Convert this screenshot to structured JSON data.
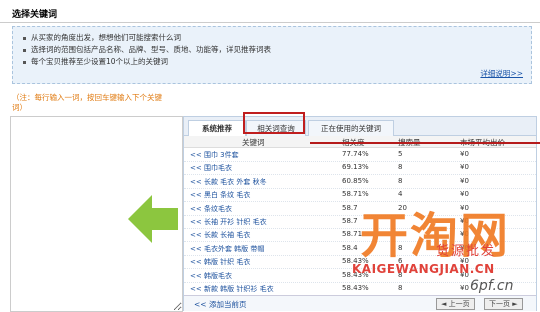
{
  "header": {
    "title": "选择关键词"
  },
  "tips": {
    "items": [
      "从买家的角度出发，想想他们可能搜索什么词",
      "选择词的范围包括产品名称、品牌、型号、质地、功能等，详见推荐词表",
      "每个宝贝推荐至少设置10个以上的关键词"
    ],
    "detail_link": "详细说明>>"
  },
  "note": {
    "text": "（注：每行输入一词，按回车键输入下个关键词）"
  },
  "tabs": [
    {
      "label": "系统推荐"
    },
    {
      "label": "相关词查询"
    },
    {
      "label": "正在使用的关键词"
    }
  ],
  "table": {
    "headers": [
      "关键词",
      "相关度",
      "搜索量",
      "市场平均出价"
    ],
    "rows": [
      {
        "keyword": "<< 围巾 3件套",
        "relevance": "77.74%",
        "volume": "5",
        "price": "¥0"
      },
      {
        "keyword": "<< 围巾毛衣",
        "relevance": "69.13%",
        "volume": "8",
        "price": "¥0"
      },
      {
        "keyword": "<< 长款 毛衣 外套 秋冬",
        "relevance": "60.85%",
        "volume": "8",
        "price": "¥0"
      },
      {
        "keyword": "<< 黑白 条纹 毛衣",
        "relevance": "58.71%",
        "volume": "4",
        "price": "¥0"
      },
      {
        "keyword": "<< 条纹毛衣",
        "relevance": "58.7",
        "volume": "20",
        "price": "¥0"
      },
      {
        "keyword": "<< 长袖 开衫 针织 毛衣",
        "relevance": "58.7",
        "volume": "",
        "price": "¥0"
      },
      {
        "keyword": "<< 长款 长袖 毛衣",
        "relevance": "58.71",
        "volume": "",
        "price": "¥0"
      },
      {
        "keyword": "<< 毛衣外套 韩版 带帽",
        "relevance": "58.4",
        "volume": "8",
        "price": "¥0"
      },
      {
        "keyword": "<< 韩版 针织 毛衣",
        "relevance": "58.43%",
        "volume": "6",
        "price": "¥0"
      },
      {
        "keyword": "<< 韩版毛衣",
        "relevance": "58.43%",
        "volume": "8",
        "price": "¥0"
      },
      {
        "keyword": "<< 新款 韩版 针织衫 毛衣",
        "relevance": "58.43%",
        "volume": "8",
        "price": "¥0"
      }
    ]
  },
  "footer": {
    "add_label": "<< 添加当前页",
    "prev_label": "◄ 上一页",
    "next_label": "下一页 ►"
  },
  "watermark": {
    "logo": "开淘网",
    "cn": "货源批发",
    "en": "KAIGEWANGJIAN.CN",
    "site": "6pf.cn"
  },
  "colors": {
    "accent_red": "#c01e1e",
    "link_blue": "#1a4f9c",
    "arrow_green": "#8cc63f",
    "watermark_orange": "#f07820"
  }
}
